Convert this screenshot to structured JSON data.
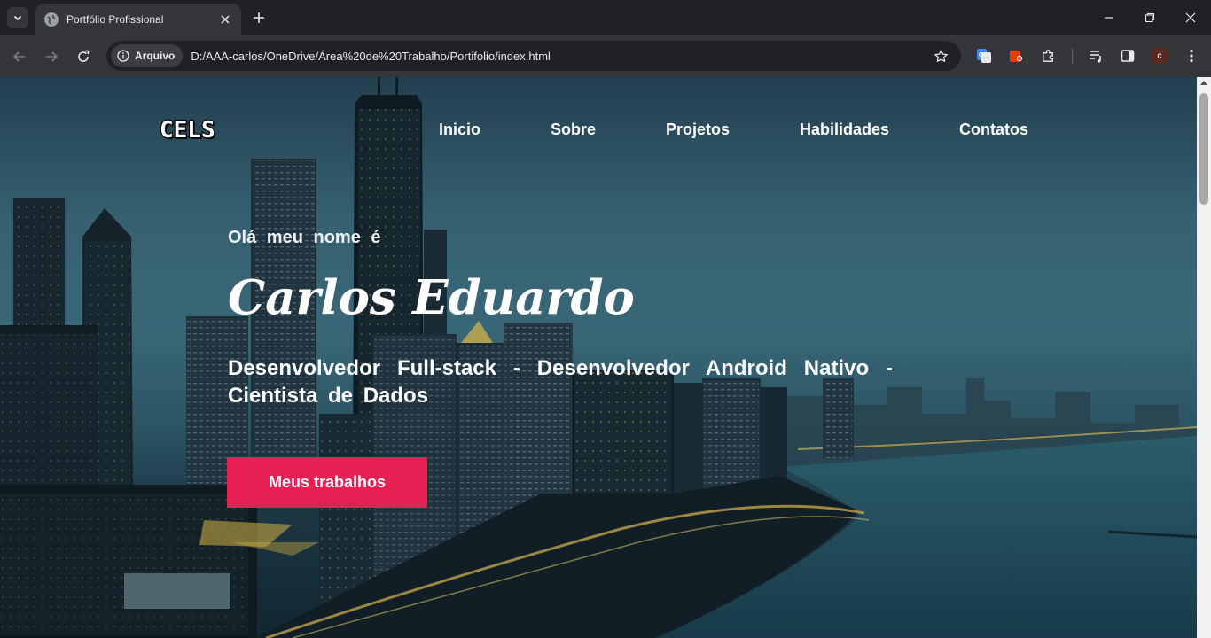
{
  "browser": {
    "tab_title": "Portfólio Profissional",
    "security_chip": "Arquivo",
    "url": "D:/AAA-carlos/OneDrive/Área%20de%20Trabalho/Portifolio/index.html",
    "profile_initial": "c"
  },
  "site": {
    "logo": "CELS",
    "nav": [
      "Inicio",
      "Sobre",
      "Projetos",
      "Habilidades",
      "Contatos"
    ],
    "hero": {
      "greeting": "Olá meu nome é",
      "name": "Carlos Eduardo",
      "role": "Desenvolvedor Full-stack - Desenvolvedor Android Nativo - Cientista de Dados",
      "cta_label": "Meus trabalhos"
    }
  },
  "colors": {
    "accent": "#e81f52",
    "chrome_dark": "#202124",
    "chrome_toolbar": "#35363a"
  }
}
